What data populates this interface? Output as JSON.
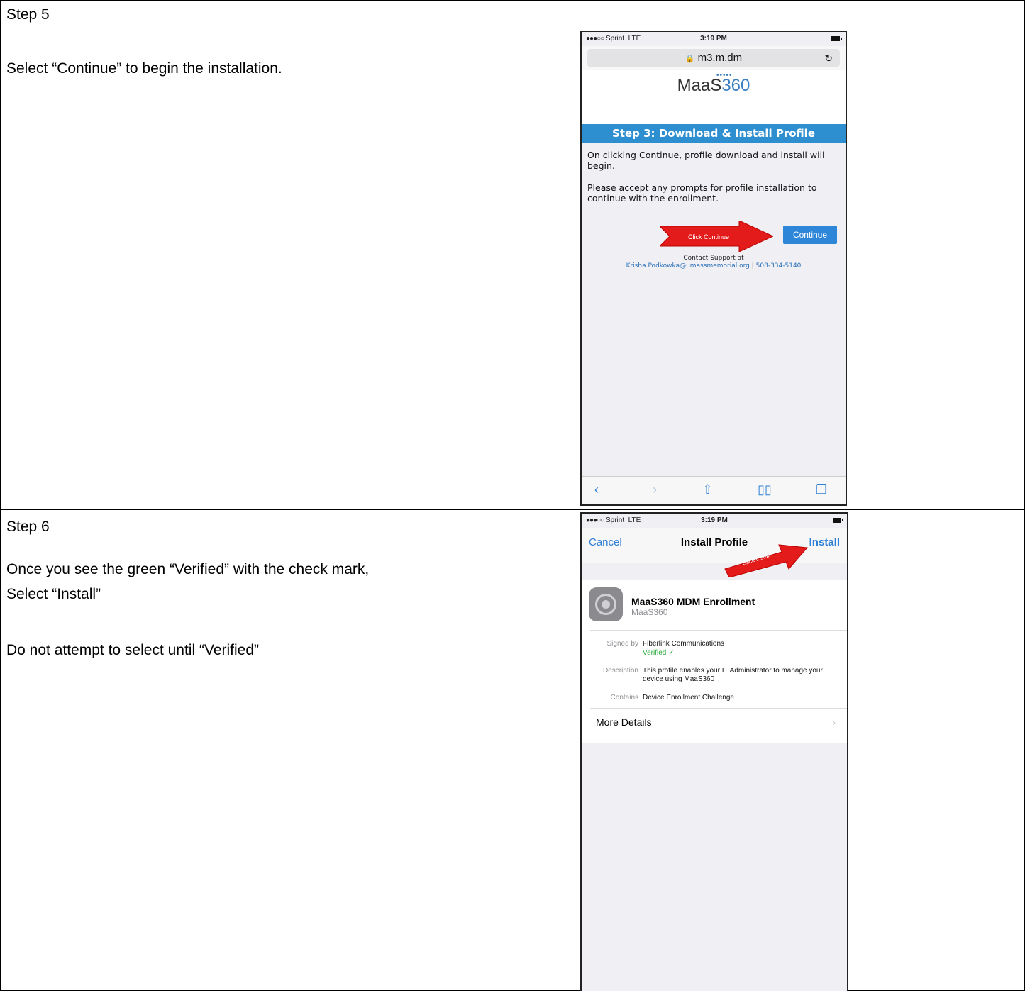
{
  "step5": {
    "title": "Step 5",
    "text": "Select “Continue” to begin the installation."
  },
  "step6": {
    "title": "Step 6",
    "text1": "Once you see the green “Verified” with the check mark, Select “Install”",
    "text2": "Do not attempt to select until “Verified”"
  },
  "phone1": {
    "status": {
      "carrier": "Sprint",
      "network": "LTE",
      "time": "3:19 PM"
    },
    "url": "m3.m.dm",
    "logo": {
      "maas": "MaaS",
      "num": "360"
    },
    "banner": "Step 3:  Download & Install Profile",
    "para1": "On clicking Continue, profile download and install will begin.",
    "para2": "Please accept any prompts for profile installation to continue with the enrollment.",
    "arrow_label": "Click Continue",
    "continue_label": "Continue",
    "support_line1": "Contact Support at",
    "support_email": "Krisha.Podkowka@umassmemorial.org",
    "support_sep": " | ",
    "support_phone": "508-334-5140"
  },
  "phone2": {
    "status": {
      "carrier": "Sprint",
      "network": "LTE",
      "time": "3:19 PM"
    },
    "cancel": "Cancel",
    "title": "Install Profile",
    "install": "Install",
    "arrow_label": "Click Install",
    "profile_name": "MaaS360 MDM Enrollment",
    "profile_org": "MaaS360",
    "signed_by_label": "Signed by",
    "signed_by_value": "Fiberlink Communications",
    "verified": "Verified ✓",
    "description_label": "Description",
    "description_value": "This profile enables your IT Administrator to manage your device using MaaS360",
    "contains_label": "Contains",
    "contains_value": "Device Enrollment Challenge",
    "more_details": "More Details"
  }
}
